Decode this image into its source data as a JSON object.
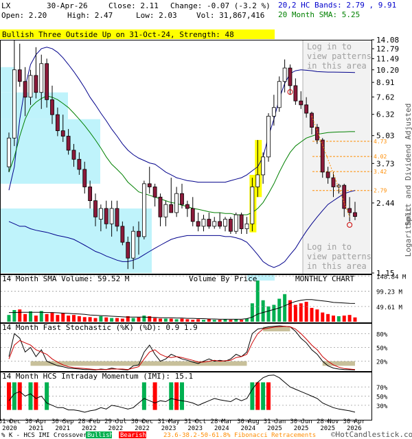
{
  "header": {
    "symbol": "LX",
    "date": "30-Apr-26",
    "close_label": "Close: 2.11",
    "change_label": "Change: -0.07 (-3.2 %)",
    "open_label": "Open: 2.20",
    "high_label": "High: 2.47",
    "low_label": "Low: 2.03",
    "vol_label": "Vol: 31,867,416",
    "hc_bands_label": "20,2 HC Bands: 2.79 , 9.91",
    "sma_label": "20 Month SMA: 5.25"
  },
  "pattern_banner": "Bullish Three Outside Up on 31-Oct-24, Strength: 48",
  "watermark_top": [
    "Log in to",
    "view patterns",
    "in this area"
  ],
  "watermark_bottom": [
    "Log in to",
    "view patterns",
    "in this area"
  ],
  "side_label": "Split and Dividend Adjusted",
  "side_label_log": "Logarithmic",
  "colors": {
    "up": "#ffffff",
    "down": "#8b1a3a",
    "hc_band": "#00008b",
    "sma": "#008000",
    "banner": "#ffff00",
    "vbp": "#bff3fb",
    "fib": "#ff8c00",
    "hcs_up": "#00b050",
    "hcs_down": "#ff0000",
    "title_blue": "#0000cc",
    "title_green": "#008000"
  },
  "chart_data": [
    {
      "type": "candlestick",
      "title": "LX",
      "y_scale": "log",
      "ylim": [
        1.15,
        14.08
      ],
      "y_ticks": [
        "14.08",
        "12.79",
        "11.49",
        "10.20",
        "8.91",
        "7.62",
        "6.32",
        "5.03",
        "3.73",
        "2.44",
        "1.15"
      ],
      "fib_levels": [
        "4.73",
        "4.02",
        "3.42",
        "2.79"
      ],
      "candles": [
        {
          "x": "2020-12",
          "o": 3.6,
          "h": 5.2,
          "l": 3.4,
          "c": 4.9
        },
        {
          "x": "2021-01",
          "o": 4.9,
          "h": 14.0,
          "l": 4.5,
          "c": 10.2
        },
        {
          "x": "2021-02",
          "o": 10.2,
          "h": 13.5,
          "l": 8.5,
          "c": 9.0
        },
        {
          "x": "2021-03",
          "o": 9.0,
          "h": 10.5,
          "l": 6.2,
          "c": 7.6
        },
        {
          "x": "2021-04",
          "o": 7.6,
          "h": 10.2,
          "l": 7.0,
          "c": 9.6
        },
        {
          "x": "2021-05",
          "o": 9.6,
          "h": 13.0,
          "l": 7.5,
          "c": 8.0
        },
        {
          "x": "2021-06",
          "o": 8.0,
          "h": 12.0,
          "l": 6.7,
          "c": 10.9
        },
        {
          "x": "2021-07",
          "o": 10.9,
          "h": 11.5,
          "l": 6.8,
          "c": 7.4
        },
        {
          "x": "2021-08",
          "o": 7.4,
          "h": 8.6,
          "l": 5.7,
          "c": 6.3
        },
        {
          "x": "2021-09",
          "o": 6.3,
          "h": 6.8,
          "l": 5.0,
          "c": 5.3
        },
        {
          "x": "2021-10",
          "o": 5.3,
          "h": 6.3,
          "l": 4.7,
          "c": 5.0
        },
        {
          "x": "2021-11",
          "o": 5.0,
          "h": 5.4,
          "l": 4.1,
          "c": 4.3
        },
        {
          "x": "2021-12",
          "o": 4.3,
          "h": 4.6,
          "l": 3.6,
          "c": 3.9
        },
        {
          "x": "2022-01",
          "o": 3.9,
          "h": 4.2,
          "l": 3.3,
          "c": 3.5
        },
        {
          "x": "2022-02",
          "o": 3.5,
          "h": 3.8,
          "l": 2.7,
          "c": 2.9
        },
        {
          "x": "2022-03",
          "o": 2.9,
          "h": 3.1,
          "l": 2.3,
          "c": 2.5
        },
        {
          "x": "2022-04",
          "o": 2.5,
          "h": 2.7,
          "l": 1.9,
          "c": 2.1
        },
        {
          "x": "2022-05",
          "o": 2.05,
          "h": 2.4,
          "l": 1.8,
          "c": 2.3
        },
        {
          "x": "2022-06",
          "o": 2.3,
          "h": 2.5,
          "l": 1.85,
          "c": 1.95
        },
        {
          "x": "2022-07",
          "o": 1.95,
          "h": 2.5,
          "l": 1.7,
          "c": 2.3
        },
        {
          "x": "2022-08",
          "o": 2.3,
          "h": 2.5,
          "l": 1.8,
          "c": 1.9
        },
        {
          "x": "2022-09",
          "o": 1.9,
          "h": 2.0,
          "l": 1.55,
          "c": 1.6
        },
        {
          "x": "2022-10",
          "o": 1.6,
          "h": 1.7,
          "l": 1.2,
          "c": 1.35
        },
        {
          "x": "2022-11",
          "o": 1.35,
          "h": 1.9,
          "l": 1.2,
          "c": 1.8
        },
        {
          "x": "2022-12",
          "o": 1.8,
          "h": 2.0,
          "l": 1.4,
          "c": 1.7
        },
        {
          "x": "2023-01",
          "o": 1.7,
          "h": 3.1,
          "l": 1.65,
          "c": 3.0
        },
        {
          "x": "2023-02",
          "o": 3.0,
          "h": 3.6,
          "l": 2.7,
          "c": 2.9
        },
        {
          "x": "2023-03",
          "o": 2.9,
          "h": 3.0,
          "l": 2.35,
          "c": 2.6
        },
        {
          "x": "2023-04",
          "o": 2.6,
          "h": 2.7,
          "l": 1.9,
          "c": 2.1
        },
        {
          "x": "2023-05",
          "o": 2.1,
          "h": 2.5,
          "l": 1.9,
          "c": 2.4
        },
        {
          "x": "2023-06",
          "o": 2.4,
          "h": 3.2,
          "l": 2.2,
          "c": 2.2
        },
        {
          "x": "2023-07",
          "o": 2.2,
          "h": 2.9,
          "l": 2.1,
          "c": 2.7
        },
        {
          "x": "2023-08",
          "o": 2.7,
          "h": 3.0,
          "l": 2.3,
          "c": 2.4
        },
        {
          "x": "2023-09",
          "o": 2.4,
          "h": 2.5,
          "l": 2.1,
          "c": 2.3
        },
        {
          "x": "2023-10",
          "o": 2.3,
          "h": 2.6,
          "l": 1.9,
          "c": 2.0
        },
        {
          "x": "2023-11",
          "o": 2.0,
          "h": 2.2,
          "l": 1.8,
          "c": 1.9
        },
        {
          "x": "2023-12",
          "o": 1.9,
          "h": 2.15,
          "l": 1.8,
          "c": 2.05
        },
        {
          "x": "2024-01",
          "o": 2.05,
          "h": 2.2,
          "l": 1.85,
          "c": 1.9
        },
        {
          "x": "2024-02",
          "o": 1.9,
          "h": 2.1,
          "l": 1.85,
          "c": 2.0
        },
        {
          "x": "2024-03",
          "o": 2.0,
          "h": 2.2,
          "l": 1.85,
          "c": 1.9
        },
        {
          "x": "2024-04",
          "o": 1.9,
          "h": 2.1,
          "l": 1.8,
          "c": 2.05
        },
        {
          "x": "2024-05",
          "o": 2.05,
          "h": 2.1,
          "l": 1.75,
          "c": 1.8
        },
        {
          "x": "2024-06",
          "o": 1.8,
          "h": 2.2,
          "l": 1.75,
          "c": 2.15
        },
        {
          "x": "2024-07",
          "o": 2.15,
          "h": 2.2,
          "l": 1.75,
          "c": 1.85
        },
        {
          "x": "2024-08",
          "o": 1.85,
          "h": 2.1,
          "l": 1.75,
          "c": 1.95
        },
        {
          "x": "2024-09",
          "o": 1.95,
          "h": 3.2,
          "l": 1.8,
          "c": 2.9
        },
        {
          "x": "2024-10",
          "o": 2.9,
          "h": 4.8,
          "l": 2.6,
          "c": 3.3
        },
        {
          "x": "2024-11",
          "o": 3.3,
          "h": 4.2,
          "l": 3.0,
          "c": 4.0
        },
        {
          "x": "2024-12",
          "o": 4.0,
          "h": 6.4,
          "l": 3.8,
          "c": 6.2
        },
        {
          "x": "2025-01",
          "o": 6.2,
          "h": 7.8,
          "l": 5.6,
          "c": 6.8
        },
        {
          "x": "2025-02",
          "o": 6.8,
          "h": 9.5,
          "l": 6.5,
          "c": 9.0
        },
        {
          "x": "2025-03",
          "o": 9.0,
          "h": 11.4,
          "l": 8.0,
          "c": 10.4
        },
        {
          "x": "2025-04",
          "o": 10.4,
          "h": 10.8,
          "l": 7.8,
          "c": 8.6
        },
        {
          "x": "2025-05",
          "o": 8.6,
          "h": 9.3,
          "l": 7.0,
          "c": 7.3
        },
        {
          "x": "2025-06",
          "o": 7.3,
          "h": 8.1,
          "l": 6.7,
          "c": 7.0
        },
        {
          "x": "2025-07",
          "o": 7.0,
          "h": 7.6,
          "l": 6.1,
          "c": 6.4
        },
        {
          "x": "2025-08",
          "o": 6.4,
          "h": 6.5,
          "l": 5.1,
          "c": 5.5
        },
        {
          "x": "2025-09",
          "o": 5.5,
          "h": 5.7,
          "l": 4.6,
          "c": 4.8
        },
        {
          "x": "2025-10",
          "o": 4.8,
          "h": 4.9,
          "l": 3.2,
          "c": 3.4
        },
        {
          "x": "2025-11",
          "o": 3.4,
          "h": 3.6,
          "l": 3.0,
          "c": 3.2
        },
        {
          "x": "2025-12",
          "o": 3.2,
          "h": 3.4,
          "l": 2.6,
          "c": 2.9
        },
        {
          "x": "2026-01",
          "o": 2.9,
          "h": 3.0,
          "l": 2.7,
          "c": 2.95
        },
        {
          "x": "2026-02",
          "o": 2.95,
          "h": 3.0,
          "l": 2.1,
          "c": 2.3
        },
        {
          "x": "2026-03",
          "o": 2.3,
          "h": 2.6,
          "l": 2.0,
          "c": 2.2
        },
        {
          "x": "2026-04",
          "o": 2.2,
          "h": 2.47,
          "l": 2.03,
          "c": 2.11
        }
      ],
      "upper_band": [
        2.8,
        3.6,
        6.0,
        8.5,
        10.8,
        12.0,
        12.8,
        13.0,
        12.8,
        12.3,
        11.6,
        10.8,
        10.0,
        9.2,
        8.4,
        7.6,
        7.0,
        6.4,
        5.9,
        5.4,
        5.0,
        4.6,
        4.3,
        4.1,
        3.95,
        3.85,
        3.75,
        3.7,
        3.55,
        3.4,
        3.3,
        3.2,
        3.15,
        3.1,
        3.08,
        3.05,
        3.05,
        3.05,
        3.05,
        3.05,
        3.05,
        3.1,
        3.15,
        3.2,
        3.3,
        3.45,
        3.6,
        4.0,
        5.0,
        6.0,
        7.5,
        8.8,
        9.8,
        10.1,
        10.2,
        10.15,
        10.1,
        10.0,
        9.98,
        9.95,
        9.95,
        9.94,
        9.93,
        9.92,
        9.91
      ],
      "sma": [
        3.4,
        4.0,
        5.0,
        6.0,
        6.8,
        7.2,
        7.5,
        7.7,
        7.6,
        7.4,
        7.1,
        6.8,
        6.4,
        6.0,
        5.6,
        5.2,
        4.8,
        4.4,
        4.0,
        3.7,
        3.5,
        3.3,
        3.05,
        2.9,
        2.75,
        2.7,
        2.65,
        2.6,
        2.55,
        2.5,
        2.45,
        2.43,
        2.38,
        2.35,
        2.3,
        2.28,
        2.25,
        2.22,
        2.2,
        2.2,
        2.18,
        2.18,
        2.15,
        2.15,
        2.15,
        2.2,
        2.3,
        2.45,
        2.7,
        3.0,
        3.4,
        3.8,
        4.2,
        4.5,
        4.7,
        4.9,
        5.0,
        5.1,
        5.15,
        5.2,
        5.22,
        5.23,
        5.24,
        5.25,
        5.25
      ],
      "lower_band": [
        2.0,
        1.95,
        1.9,
        1.9,
        1.85,
        1.82,
        1.8,
        1.78,
        1.75,
        1.72,
        1.7,
        1.68,
        1.65,
        1.6,
        1.55,
        1.5,
        1.45,
        1.42,
        1.38,
        1.35,
        1.32,
        1.3,
        1.3,
        1.32,
        1.35,
        1.4,
        1.45,
        1.5,
        1.55,
        1.6,
        1.65,
        1.68,
        1.7,
        1.72,
        1.72,
        1.72,
        1.72,
        1.72,
        1.72,
        1.72,
        1.7,
        1.7,
        1.68,
        1.65,
        1.6,
        1.5,
        1.4,
        1.3,
        1.25,
        1.22,
        1.25,
        1.3,
        1.4,
        1.5,
        1.65,
        1.8,
        1.95,
        2.1,
        2.25,
        2.4,
        2.5,
        2.6,
        2.7,
        2.75,
        2.79
      ]
    },
    {
      "type": "bar",
      "title": "14 Month SMA Volume: 59.52 M",
      "center_label": "Volume By Price",
      "right_label": "MONTHLY CHART",
      "y_ticks": [
        "148.84 M",
        "99.23 M",
        "49.61 M"
      ],
      "ylim": [
        0,
        150
      ],
      "values": [
        22,
        38,
        40,
        25,
        34,
        20,
        35,
        25,
        30,
        22,
        28,
        20,
        22,
        18,
        15,
        15,
        12,
        18,
        14,
        12,
        12,
        10,
        18,
        12,
        14,
        20,
        18,
        12,
        10,
        10,
        10,
        8,
        10,
        8,
        6,
        8,
        6,
        8,
        6,
        6,
        8,
        6,
        8,
        6,
        10,
        60,
        140,
        70,
        50,
        55,
        75,
        90,
        70,
        55,
        60,
        65,
        45,
        40,
        30,
        25,
        20,
        18,
        20,
        22,
        14
      ],
      "sma_line": [
        30,
        30,
        31,
        31,
        31,
        31,
        31,
        30,
        30,
        29,
        28,
        27,
        26,
        25,
        24,
        22,
        21,
        20,
        19,
        18,
        17,
        16,
        15,
        15,
        15,
        15,
        14,
        14,
        13,
        13,
        13,
        12,
        12,
        11,
        11,
        10,
        10,
        9,
        9,
        8,
        8,
        8,
        8,
        8,
        10,
        15,
        25,
        30,
        35,
        40,
        45,
        52,
        60,
        66,
        70,
        72,
        72,
        70,
        68,
        66,
        63,
        62,
        61,
        60,
        59.52
      ]
    },
    {
      "type": "line",
      "title": "14 Month Fast Stochastic (%K) (%D): 0.9  1.9",
      "y_ticks": [
        "80%",
        "50%",
        "20%"
      ],
      "ylim": [
        0,
        100
      ],
      "k_values": [
        30,
        80,
        70,
        40,
        50,
        30,
        45,
        20,
        15,
        10,
        8,
        5,
        4,
        3,
        2,
        2,
        1,
        3,
        2,
        5,
        3,
        2,
        1,
        10,
        12,
        40,
        55,
        35,
        20,
        25,
        35,
        30,
        25,
        22,
        18,
        15,
        20,
        25,
        20,
        22,
        20,
        25,
        35,
        30,
        40,
        80,
        90,
        92,
        95,
        96,
        97,
        96,
        95,
        85,
        70,
        60,
        45,
        35,
        20,
        10,
        5,
        3,
        2,
        1.5,
        0.9
      ],
      "d_values": [
        25,
        55,
        65,
        60,
        55,
        45,
        40,
        35,
        25,
        18,
        12,
        8,
        6,
        5,
        4,
        3,
        2,
        2,
        2,
        3,
        3,
        3,
        2,
        5,
        8,
        25,
        40,
        45,
        35,
        30,
        28,
        30,
        28,
        25,
        22,
        18,
        18,
        20,
        22,
        20,
        21,
        22,
        28,
        30,
        35,
        60,
        80,
        90,
        92,
        94,
        95,
        96,
        95,
        90,
        80,
        68,
        55,
        45,
        30,
        20,
        12,
        7,
        4,
        3,
        1.9
      ]
    },
    {
      "type": "line",
      "title": "14 Month HCS Intraday Momentum (IMI): 15.1",
      "y_ticks": [
        "70%",
        "50%",
        "30%"
      ],
      "ylim": [
        0,
        100
      ],
      "values": [
        40,
        55,
        60,
        50,
        55,
        45,
        50,
        35,
        30,
        25,
        25,
        20,
        20,
        18,
        15,
        18,
        20,
        25,
        22,
        30,
        28,
        25,
        22,
        25,
        35,
        45,
        40,
        35,
        40,
        38,
        45,
        42,
        40,
        38,
        35,
        30,
        35,
        40,
        45,
        42,
        40,
        38,
        45,
        40,
        45,
        65,
        80,
        90,
        95,
        96,
        90,
        80,
        70,
        65,
        60,
        55,
        50,
        45,
        35,
        30,
        25,
        22,
        20,
        18,
        15.1
      ],
      "bullish_markers": [
        "2021-01",
        "2021-04",
        "2021-07",
        "2023-01",
        "2023-06",
        "2023-08",
        "2024-09",
        "2024-11"
      ],
      "bearish_markers": [
        "2020-12",
        "2021-02",
        "2021-05",
        "2023-03",
        "2023-07",
        "2024-10",
        "2024-12"
      ]
    }
  ],
  "x_tick_labels": [
    "31-Dec\n2020",
    "30-Apr\n2021",
    "30-Sep\n2021",
    "28-Feb\n2022",
    "29-Jul\n2022",
    "30-Dec\n2022",
    "31-May\n2023",
    "31-Oct\n2023",
    "28-Mar\n2024",
    "30-Aug\n2024",
    "31-Jan\n2025",
    "30-Jun\n2025",
    "28-Nov\n2025",
    "30-Apr\n2026"
  ],
  "footer": {
    "legend_text": "% K - HCS IMI Crossover:",
    "bullish": "Bullish",
    "bearish": "Bearish",
    "fib_text": "23.6-38.2-50-61.8% Fibonacci Retracements",
    "copyright": "©HotCandlestick.com"
  }
}
